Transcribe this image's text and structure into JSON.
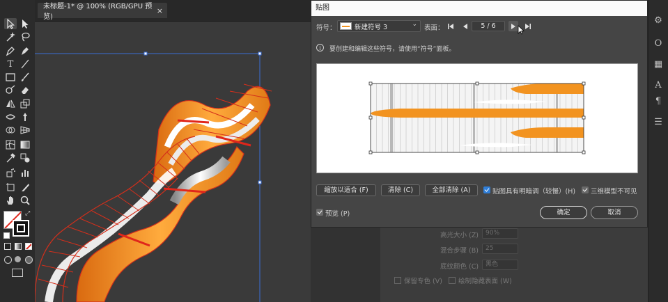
{
  "document": {
    "tab_title": "未标题-1* @ 100% (RGB/GPU 预览)",
    "close_glyph": "×"
  },
  "toolbar": {
    "tools": [
      "selection-tool",
      "direct-selection-tool",
      "magic-wand-tool",
      "lasso-tool",
      "pen-tool",
      "curvature-tool",
      "type-tool",
      "line-tool",
      "rectangle-tool",
      "paintbrush-tool",
      "shaper-tool",
      "eraser-tool",
      "rotate-tool",
      "scale-tool",
      "width-tool",
      "free-transform-tool",
      "shape-builder-tool",
      "perspective-grid-tool",
      "mesh-tool",
      "gradient-tool",
      "eyedropper-tool",
      "blend-tool",
      "symbol-sprayer-tool",
      "column-graph-tool",
      "artboard-tool",
      "slice-tool",
      "hand-tool",
      "zoom-tool"
    ]
  },
  "dialog": {
    "title": "贴图",
    "symbol_label": "符号：",
    "symbol_value": "新建符号 3",
    "surface_label": "表面：",
    "page_indicator": "5 / 6",
    "info_text": "要创建和编辑这些符号，请使用“符号”面板。",
    "buttons": {
      "fit": "缩放以适合 (F)",
      "clear": "清除 (C)",
      "clear_all": "全部清除 (A)",
      "ok": "确定",
      "cancel": "取消"
    },
    "checkboxes": {
      "shade_artwork": "贴图具有明暗调（较慢）(H)",
      "invisible_geometry": "三维模型不可见",
      "preview": "预览 (P)"
    }
  },
  "bg_panel": {
    "highlight_size_label": "高光大小 (Z)",
    "highlight_size_value": "90%",
    "blend_steps_label": "混合步骤 (B)",
    "blend_steps_value": "25",
    "shade_color_label": "底纹颜色 (C)",
    "shade_color_value": "黑色",
    "preserve_spot": "保留专色 (V)",
    "draw_hidden": "绘制隐藏表面 (W)"
  },
  "colors": {
    "accent_orange": "#f29320",
    "accent_red": "#e0261b",
    "selection_blue": "#3b6fd6"
  }
}
